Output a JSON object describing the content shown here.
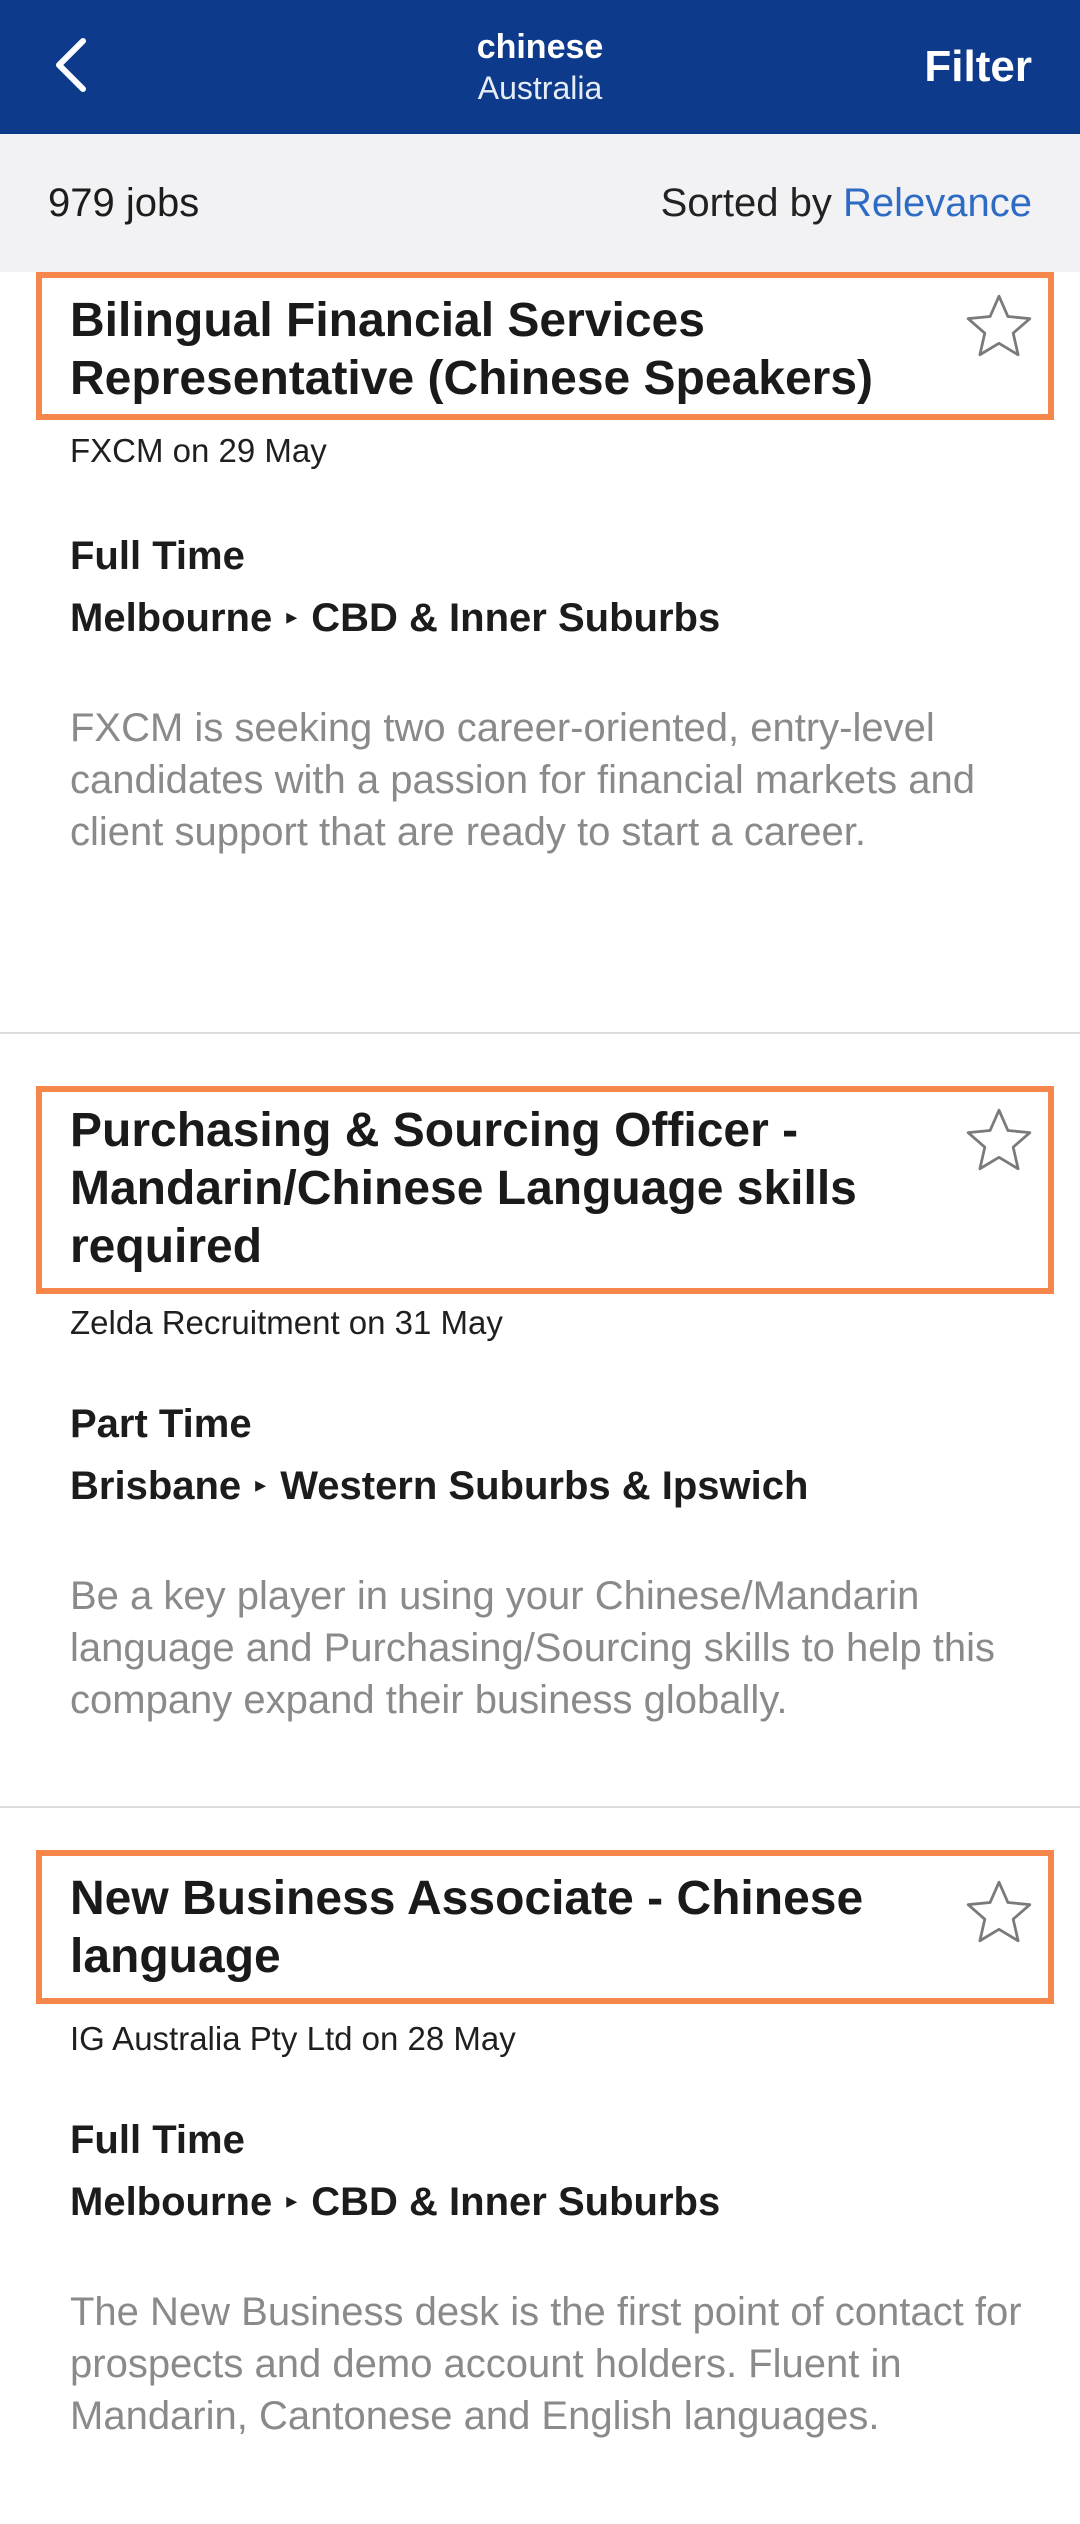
{
  "navbar": {
    "query": "chinese",
    "location": "Australia",
    "filter_label": "Filter"
  },
  "summary": {
    "count": "979 jobs",
    "sorted_prefix": "Sorted by",
    "sort_value": "Relevance"
  },
  "jobs": [
    {
      "title": "Bilingual Financial Services Representative (Chinese Speakers)",
      "meta": "FXCM on 29 May",
      "work_type": "Full Time",
      "city": "Melbourne",
      "area": "CBD & Inner Suburbs",
      "description": "FXCM is seeking two career-oriented, entry-level candidates with a passion for financial markets and client support that are ready to start a career."
    },
    {
      "title": "Purchasing & Sourcing Officer - Mandarin/Chinese Language skills required",
      "meta": "Zelda Recruitment on 31 May",
      "work_type": "Part Time",
      "city": "Brisbane",
      "area": "Western Suburbs & Ipswich",
      "description": "Be a key player in using your Chinese/Mandarin language and Purchasing/Sourcing skills to help this company expand their business globally."
    },
    {
      "title": "New Business Associate - Chinese language",
      "meta": "IG Australia Pty Ltd on 28 May",
      "work_type": "Full Time",
      "city": "Melbourne",
      "area": "CBD & Inner Suburbs",
      "description": "The New Business desk is the first point of contact for prospects and demo account holders. Fluent in Mandarin, Cantonese and English languages."
    }
  ],
  "colors": {
    "navbar_bg": "#0d3a8a",
    "accent_link": "#2d6bc4",
    "highlight_border": "#f5874b"
  },
  "icons": {
    "back": "chevron-left-icon",
    "save": "star-outline-icon"
  }
}
